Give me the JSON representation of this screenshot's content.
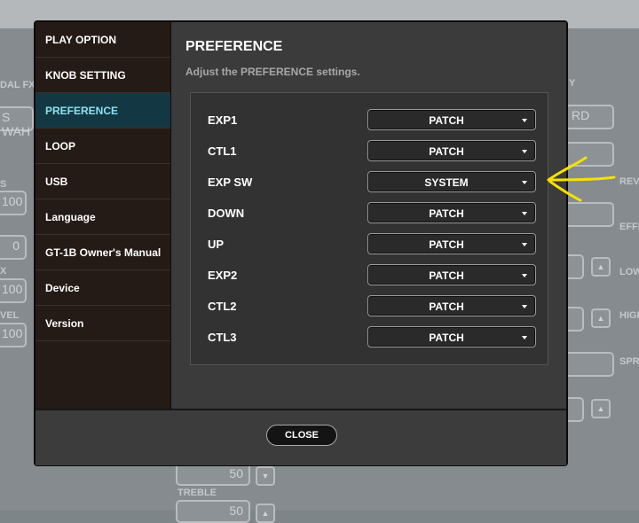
{
  "background": {
    "labels": [
      "DAL FX",
      "S WAH",
      "S",
      "100",
      "0",
      "X",
      "100",
      "VEL",
      "100",
      "Y",
      "RD",
      "REVE",
      "EFFE",
      "LOW",
      "HIGH",
      "SPR",
      "50",
      "TREBLE",
      "50"
    ]
  },
  "dialog": {
    "sidebar": {
      "items": [
        {
          "label": "PLAY OPTION",
          "active": false
        },
        {
          "label": "KNOB SETTING",
          "active": false
        },
        {
          "label": "PREFERENCE",
          "active": true
        },
        {
          "label": "LOOP",
          "active": false
        },
        {
          "label": "USB",
          "active": false
        },
        {
          "label": "Language",
          "active": false
        },
        {
          "label": "GT-1B Owner's Manual",
          "active": false
        },
        {
          "label": "Device",
          "active": false
        },
        {
          "label": "Version",
          "active": false
        }
      ]
    },
    "content": {
      "title": "PREFERENCE",
      "subtitle": "Adjust the PREFERENCE settings.",
      "rows": [
        {
          "label": "EXP1",
          "value": "PATCH"
        },
        {
          "label": "CTL1",
          "value": "PATCH"
        },
        {
          "label": "EXP SW",
          "value": "SYSTEM"
        },
        {
          "label": "DOWN",
          "value": "PATCH"
        },
        {
          "label": "UP",
          "value": "PATCH"
        },
        {
          "label": "EXP2",
          "value": "PATCH"
        },
        {
          "label": "CTL2",
          "value": "PATCH"
        },
        {
          "label": "CTL3",
          "value": "PATCH"
        }
      ]
    },
    "footer": {
      "close_label": "CLOSE"
    }
  },
  "colors": {
    "active_item_bg": "#133844",
    "active_item_text": "#8fe0ee",
    "annotation": "#f5e100"
  },
  "icons": {
    "select_caret": "caret-down-icon",
    "annotation": "arrow-left-icon"
  }
}
